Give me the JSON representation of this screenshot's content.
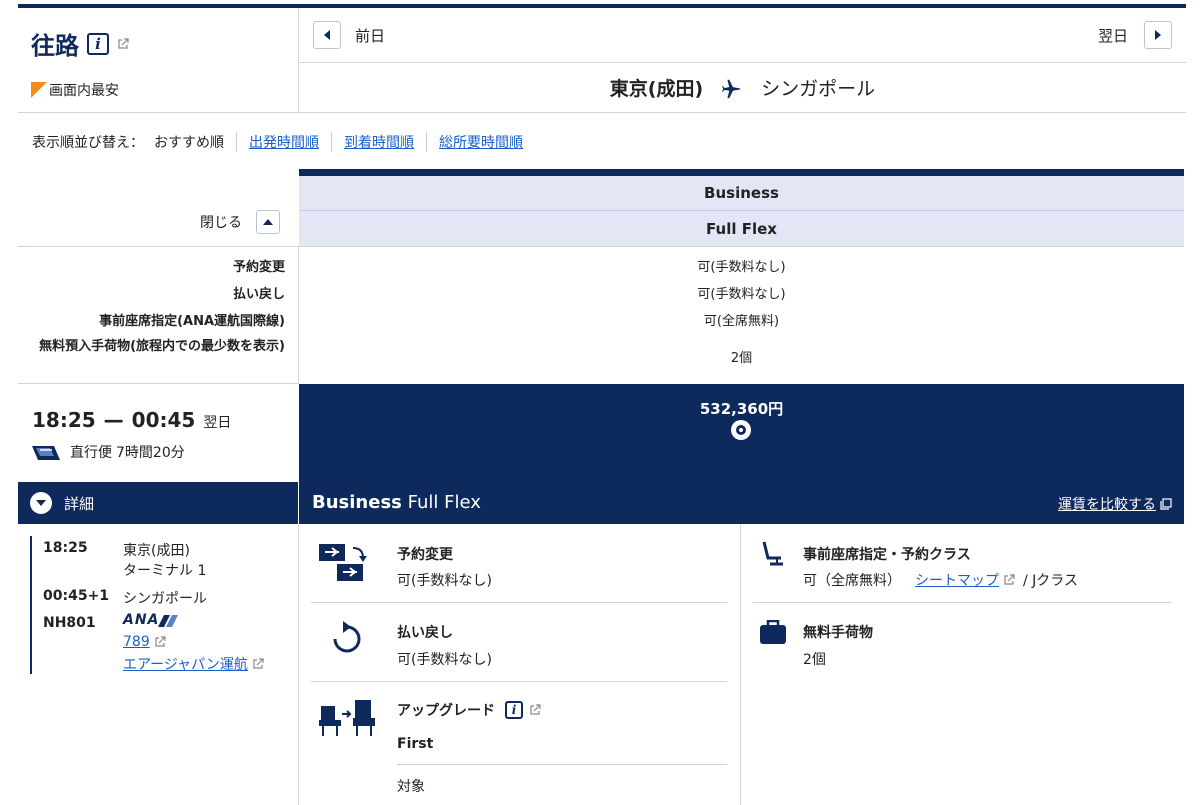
{
  "header": {
    "outbound_title": "往路",
    "cheapest_label": "画面内最安",
    "prev_day": "前日",
    "next_day": "翌日",
    "origin": "東京(成田)",
    "destination": "シンガポール"
  },
  "sort": {
    "label": "表示順並び替え：",
    "current": "おすすめ順",
    "options": [
      "出発時間順",
      "到着時間順",
      "総所要時間順"
    ]
  },
  "fare_header": {
    "cabin": "Business",
    "fare_type": "Full Flex",
    "close_label": "閉じる"
  },
  "conditions": [
    {
      "label": "予約変更",
      "value": "可(手数料なし)"
    },
    {
      "label": "払い戻し",
      "value": "可(手数料なし)"
    },
    {
      "label": "事前座席指定(ANA運航国際線)",
      "value": "可(全席無料)"
    },
    {
      "label": "無料預入手荷物(旅程内での最少数を表示)",
      "value": "2個"
    }
  ],
  "flight": {
    "depart": "18:25",
    "arrive": "00:45",
    "next_day_mark": "翌日",
    "dash": "—",
    "type": "直行便",
    "duration": "7時間20分",
    "price": "532,360円",
    "details_label": "詳細",
    "detail": {
      "dep_time": "18:25",
      "dep_airport": "東京(成田)",
      "terminal": "ターミナル 1",
      "arr_time": "00:45+1",
      "arr_airport": "シンガポール",
      "flight_no": "NH801",
      "airline_logo": "ANA",
      "aircraft": "789",
      "operator": "エアージャパン運航"
    }
  },
  "fare_panel": {
    "title_cabin": "Business",
    "title_fare": "Full Flex",
    "compare_label": "運賃を比較する",
    "change": {
      "title": "予約変更",
      "value": "可(手数料なし)"
    },
    "refund": {
      "title": "払い戻し",
      "value": "可(手数料なし)"
    },
    "upgrade": {
      "title": "アップグレード",
      "class": "First",
      "status": "対象"
    },
    "seat": {
      "title": "事前座席指定・予約クラス",
      "value": "可（全席無料）",
      "seatmap": "シートマップ",
      "booking_class": "/ Jクラス"
    },
    "baggage": {
      "title": "無料手荷物",
      "value": "2個"
    }
  },
  "colors": {
    "navy": "#0e2a5c",
    "link": "#1a5fc9",
    "highlight": "#f28c1e",
    "header_bg": "#e3e6f5"
  }
}
